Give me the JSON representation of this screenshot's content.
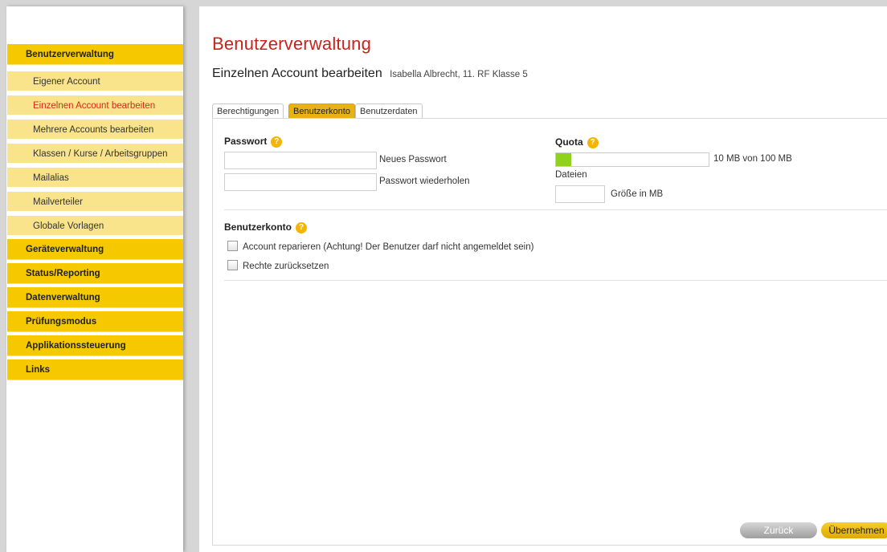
{
  "sidebar": {
    "items": [
      {
        "label": "Benutzerverwaltung",
        "type": "section"
      },
      {
        "label": "Eigener Account",
        "type": "sub"
      },
      {
        "label": "Einzelnen Account bearbeiten",
        "type": "sub",
        "active": true
      },
      {
        "label": "Mehrere Accounts bearbeiten",
        "type": "sub"
      },
      {
        "label": "Klassen / Kurse / Arbeitsgruppen",
        "type": "sub"
      },
      {
        "label": "Mailalias",
        "type": "sub"
      },
      {
        "label": "Mailverteiler",
        "type": "sub"
      },
      {
        "label": "Globale Vorlagen",
        "type": "sub"
      },
      {
        "label": "Geräteverwaltung",
        "type": "section"
      },
      {
        "label": "Status/Reporting",
        "type": "section"
      },
      {
        "label": "Datenverwaltung",
        "type": "section"
      },
      {
        "label": "Prüfungsmodus",
        "type": "section"
      },
      {
        "label": "Applikationssteuerung",
        "type": "section"
      },
      {
        "label": "Links",
        "type": "section"
      }
    ]
  },
  "header": {
    "title": "Benutzerverwaltung",
    "subtitle": "Einzelnen Account bearbeiten",
    "user_info": "Isabella Albrecht, 11. RF Klasse 5"
  },
  "tabs": [
    {
      "label": "Berechtigungen",
      "active": false
    },
    {
      "label": "Benutzerkonto",
      "active": true
    },
    {
      "label": "Benutzerdaten",
      "active": false
    }
  ],
  "password": {
    "title": "Passwort",
    "help_icon": "?",
    "new_label": "Neues Passwort",
    "new_value": "",
    "repeat_label": "Passwort wiederholen",
    "repeat_value": ""
  },
  "quota": {
    "title": "Quota",
    "help_icon": "?",
    "usage_text": "10 MB von 100 MB",
    "used_fraction": 0.1,
    "files_label": "Dateien",
    "size_label": "Größe in MB",
    "size_value": ""
  },
  "account": {
    "title": "Benutzerkonto",
    "help_icon": "?",
    "repair_label": "Account reparieren (Achtung! Der Benutzer darf nicht angemeldet sein)",
    "repair_checked": false,
    "reset_label": "Rechte zurücksetzen",
    "reset_checked": false
  },
  "buttons": {
    "back": "Zurück",
    "apply": "Übernehmen"
  },
  "colors": {
    "accent": "#f5c800",
    "title": "#c8221c",
    "quota_fill": "#8fd21a"
  }
}
